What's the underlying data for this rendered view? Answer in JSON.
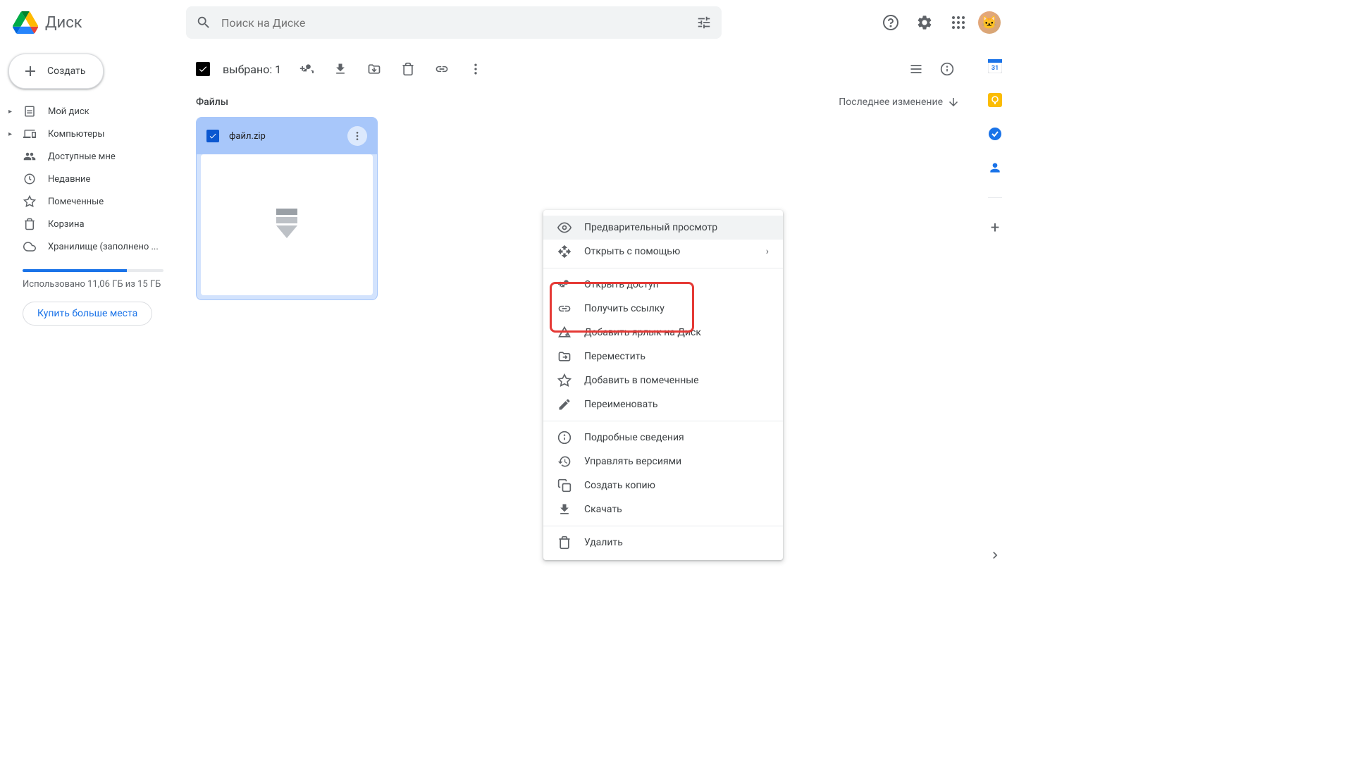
{
  "header": {
    "product_name": "Диск",
    "search_placeholder": "Поиск на Диске"
  },
  "sidebar": {
    "create_label": "Создать",
    "items": [
      {
        "label": "Мой диск",
        "icon": "drive"
      },
      {
        "label": "Компьютеры",
        "icon": "devices"
      },
      {
        "label": "Доступные мне",
        "icon": "people"
      },
      {
        "label": "Недавние",
        "icon": "clock"
      },
      {
        "label": "Помеченные",
        "icon": "star"
      },
      {
        "label": "Корзина",
        "icon": "trash"
      },
      {
        "label": "Хранилище (заполнено ...",
        "icon": "cloud"
      }
    ],
    "storage_used_text": "Использовано 11,06 ГБ из 15 ГБ",
    "storage_fill_pct": 74,
    "buy_more_label": "Купить больше места"
  },
  "toolbar": {
    "selected_text": "выбрано: 1"
  },
  "main": {
    "section_title": "Файлы",
    "sort_label": "Последнее изменение",
    "file": {
      "name": "файл.zip"
    }
  },
  "context_menu": {
    "items": [
      {
        "label": "Предварительный просмотр",
        "icon": "eye",
        "hover": true
      },
      {
        "label": "Открыть с помощью",
        "icon": "open-with",
        "arrow": true
      },
      {
        "sep": true
      },
      {
        "label": "Открыть доступ",
        "icon": "person-add"
      },
      {
        "label": "Получить ссылку",
        "icon": "link"
      },
      {
        "label": "Добавить ярлык на Диск",
        "icon": "drive-shortcut"
      },
      {
        "label": "Переместить",
        "icon": "move"
      },
      {
        "label": "Добавить в помеченные",
        "icon": "star"
      },
      {
        "label": "Переименовать",
        "icon": "rename"
      },
      {
        "sep": true
      },
      {
        "label": "Подробные сведения",
        "icon": "info"
      },
      {
        "label": "Управлять версиями",
        "icon": "history"
      },
      {
        "label": "Создать копию",
        "icon": "copy"
      },
      {
        "label": "Скачать",
        "icon": "download"
      },
      {
        "sep": true
      },
      {
        "label": "Удалить",
        "icon": "trash"
      }
    ]
  }
}
